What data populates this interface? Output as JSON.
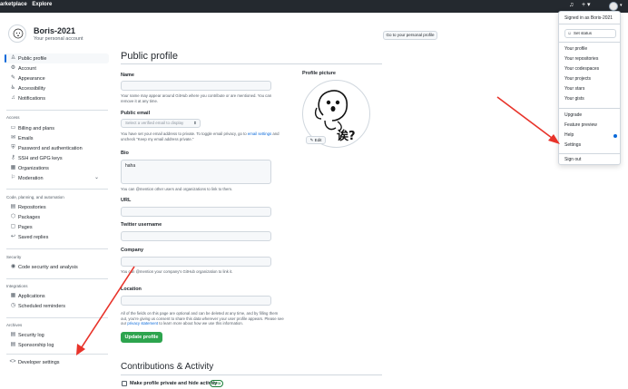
{
  "topbar": {
    "nav": [
      "arketplace",
      "Explore"
    ]
  },
  "user": {
    "name": "Boris-2021",
    "subtitle": "Your personal account"
  },
  "header": {
    "goto_label": "Go to your personal profile"
  },
  "sidebar": {
    "top": [
      {
        "label": "Public profile",
        "icon": "person-icon",
        "glyph": "♙"
      },
      {
        "label": "Account",
        "icon": "gear-icon",
        "glyph": "⚙"
      },
      {
        "label": "Appearance",
        "icon": "paintbrush-icon",
        "glyph": "✎"
      },
      {
        "label": "Accessibility",
        "icon": "accessibility-icon",
        "glyph": "♿"
      },
      {
        "label": "Notifications",
        "icon": "bell-icon",
        "glyph": "♫"
      }
    ],
    "access_heading": "Access",
    "access": [
      {
        "label": "Billing and plans",
        "icon": "credit-card-icon",
        "glyph": "▭"
      },
      {
        "label": "Emails",
        "icon": "mail-icon",
        "glyph": "✉"
      },
      {
        "label": "Password and authentication",
        "icon": "shield-lock-icon",
        "glyph": "⛨"
      },
      {
        "label": "SSH and GPG keys",
        "icon": "key-icon",
        "glyph": "⚷"
      },
      {
        "label": "Organizations",
        "icon": "organization-icon",
        "glyph": "▦"
      },
      {
        "label": "Moderation",
        "icon": "report-icon",
        "glyph": "⚐"
      }
    ],
    "code_heading": "Code, planning, and automation",
    "code": [
      {
        "label": "Repositories",
        "icon": "repo-icon",
        "glyph": "▤"
      },
      {
        "label": "Packages",
        "icon": "package-icon",
        "glyph": "⬡"
      },
      {
        "label": "Pages",
        "icon": "browser-icon",
        "glyph": "▢"
      },
      {
        "label": "Saved replies",
        "icon": "reply-icon",
        "glyph": "↩"
      }
    ],
    "security_heading": "Security",
    "security": [
      {
        "label": "Code security and analysis",
        "icon": "codescan-icon",
        "glyph": "◉"
      }
    ],
    "integrations_heading": "Integrations",
    "integrations": [
      {
        "label": "Applications",
        "icon": "apps-icon",
        "glyph": "▦"
      },
      {
        "label": "Scheduled reminders",
        "icon": "clock-icon",
        "glyph": "◷"
      }
    ],
    "archives_heading": "Archives",
    "archives": [
      {
        "label": "Security log",
        "icon": "log-icon",
        "glyph": "▤"
      },
      {
        "label": "Sponsorship log",
        "icon": "log-icon",
        "glyph": "▤"
      }
    ],
    "developer": {
      "label": "Developer settings",
      "icon": "code-icon",
      "glyph": "<>"
    }
  },
  "main": {
    "title": "Public profile",
    "name_label": "Name",
    "name_note": "Your name may appear around GitHub where you contribute or are mentioned. You can remove it at any time.",
    "email_label": "Public email",
    "email_placeholder": "Select a verified email to display",
    "email_note_a": "You have set your email address to private. To toggle email privacy, go to ",
    "email_note_link": "email settings",
    "email_note_b": " and uncheck \"Keep my email address private.\"",
    "bio_label": "Bio",
    "bio_value": "haha",
    "bio_note": "You can @mention other users and organizations to link to them.",
    "url_label": "URL",
    "twitter_label": "Twitter username",
    "company_label": "Company",
    "company_note": "You can @mention your company's GitHub organization to link it.",
    "location_label": "Location",
    "privacy_note_a": "All of the fields on this page are optional and can be deleted at any time, and by filling them out, you're giving us consent to share this data wherever your user profile appears. Please see our ",
    "privacy_note_link": "privacy statement",
    "privacy_note_b": " to learn more about how we use this information.",
    "update_label": "Update profile",
    "contrib_title": "Contributions & Activity",
    "private_label": "Make profile private and hide activity",
    "beta_label": "Beta",
    "picture_label": "Profile picture",
    "edit_label": "Edit",
    "avatar_text": "诶?"
  },
  "dropdown": {
    "signed_in": "Signed in as Boris-2021",
    "set_status": "Set status",
    "group1": [
      "Your profile",
      "Your repositories",
      "Your codespaces",
      "Your projects",
      "Your stars",
      "Your gists"
    ],
    "group2": [
      "Upgrade",
      "Feature preview",
      "Help",
      "Settings"
    ],
    "sign_out": "Sign out"
  },
  "colors": {
    "accent": "#0969da",
    "primary_button": "#2da44e",
    "annotation_arrow": "#e8332a",
    "topbar": "#24292f"
  }
}
